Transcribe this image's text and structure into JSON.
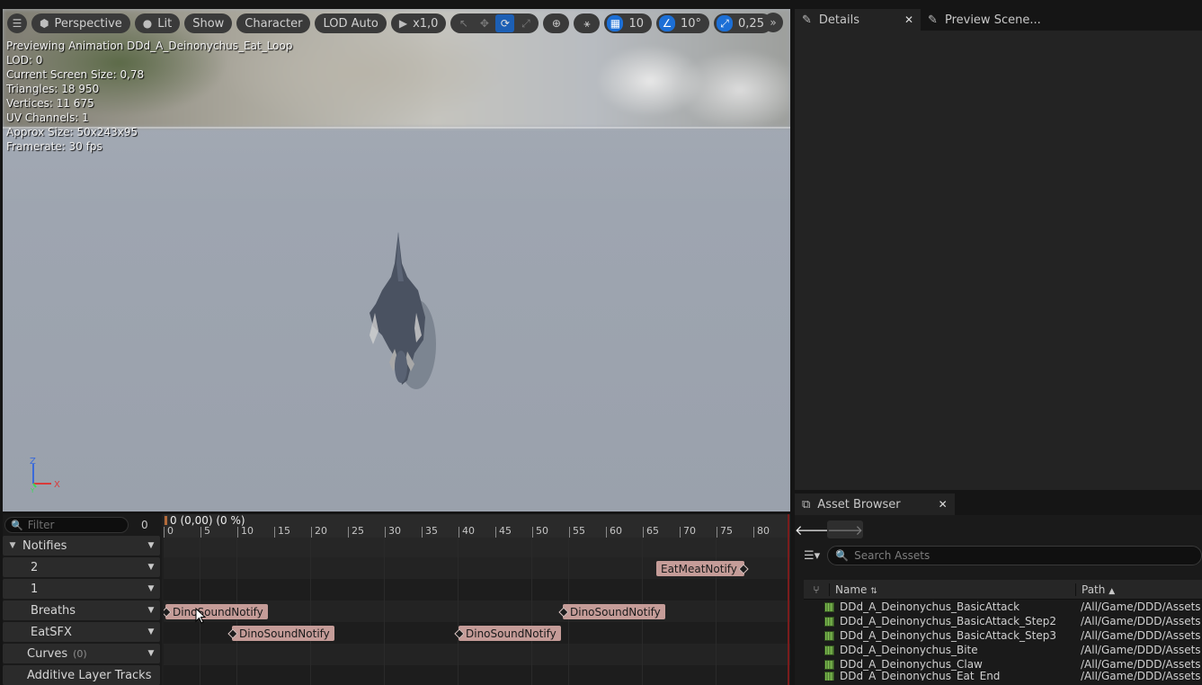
{
  "viewport": {
    "toolbar": {
      "menu_icon": "hamburger-icon",
      "perspective_label": "Perspective",
      "lit_label": "Lit",
      "show_label": "Show",
      "character_label": "Character",
      "lod_label": "LOD Auto",
      "speed_label": "x1,0",
      "grid_snap_value": "10",
      "rotation_snap_value": "10°",
      "scale_snap_value": "0,25"
    },
    "stats": [
      "Previewing Animation DDd_A_Deinonychus_Eat_Loop",
      "LOD: 0",
      "Current Screen Size: 0,78",
      "Triangles: 18 950",
      "Vertices: 11 675",
      "UV Channels: 1",
      "Approx Size: 50x243x95",
      "Framerate: 30 fps"
    ],
    "axis": {
      "z": "Z",
      "x": "X",
      "y": "Y"
    },
    "colors": {
      "axis_x": "#d93a3a",
      "axis_z": "#3a6ad9",
      "axis_y": "#3ad95a"
    }
  },
  "details_panel": {
    "tabs": [
      {
        "label": "Details",
        "icon": "pencil-icon",
        "closable": true
      },
      {
        "label": "Preview Scene...",
        "icon": "pencil-icon",
        "closable": false
      }
    ]
  },
  "asset_browser": {
    "tab_label": "Asset Browser",
    "search_placeholder": "Search Assets",
    "columns": {
      "name": "Name",
      "path": "Path"
    },
    "rows": [
      {
        "name": "DDd_A_Deinonychus_BasicAttack",
        "path": "/All/Game/DDD/Assets"
      },
      {
        "name": "DDd_A_Deinonychus_BasicAttack_Step2",
        "path": "/All/Game/DDD/Assets"
      },
      {
        "name": "DDd_A_Deinonychus_BasicAttack_Step3",
        "path": "/All/Game/DDD/Assets"
      },
      {
        "name": "DDd_A_Deinonychus_Bite",
        "path": "/All/Game/DDD/Assets"
      },
      {
        "name": "DDd_A_Deinonychus_Claw",
        "path": "/All/Game/DDD/Assets"
      },
      {
        "name": "DDd_A_Deinonychus_Eat_End",
        "path": "/All/Game/DDD/Assets"
      }
    ]
  },
  "timeline": {
    "filter_placeholder": "Filter",
    "filter_count": "0",
    "playhead_label": "0 (0,00) (0 %)",
    "ticks": [
      "0",
      "5",
      "10",
      "15",
      "20",
      "25",
      "30",
      "35",
      "40",
      "45",
      "50",
      "55",
      "60",
      "65",
      "70",
      "75",
      "80"
    ],
    "tracks": {
      "notifies": "Notifies",
      "track_2": "2",
      "track_1": "1",
      "breaths": "Breaths",
      "eatsfx": "EatSFX",
      "curves": "Curves",
      "curves_count": "(0)",
      "additive": "Additive Layer Tracks"
    },
    "notifies": {
      "eat_meat": "EatMeatNotify",
      "breath_a": "DinoSoundNotify",
      "breath_b": "DinoSoundNotify",
      "eat_a": "DinoSoundNotify",
      "eat_b": "DinoSoundNotify"
    },
    "colors": {
      "notify": "#c59c98",
      "end_marker": "#7a1c1c"
    }
  }
}
